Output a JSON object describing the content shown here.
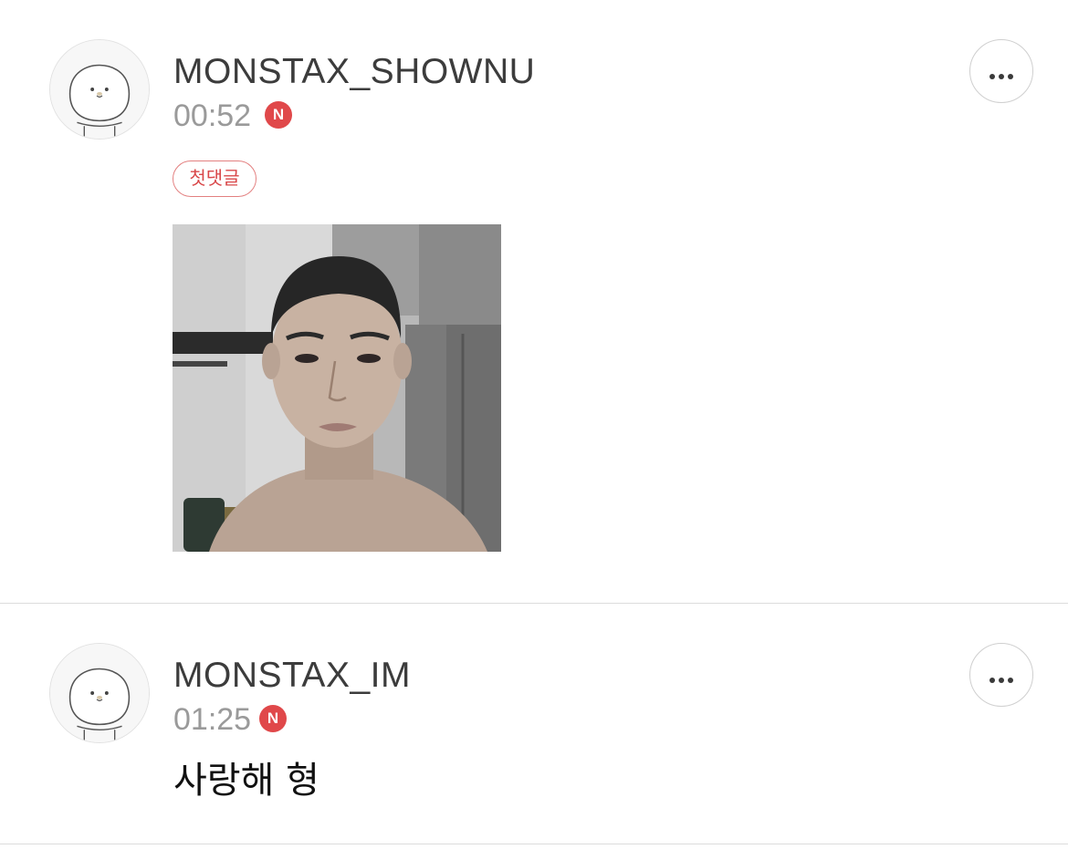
{
  "comments": [
    {
      "username": "MONSTAX_SHOWNU",
      "time": "00:52",
      "new_badge": "N",
      "tag": "첫댓글",
      "attachment_icon": "selfie-photo",
      "more_icon": "more-dots-icon"
    },
    {
      "username": "MONSTAX_IM",
      "time": "01:25",
      "new_badge": "N",
      "text": "사랑해 형",
      "more_icon": "more-dots-icon"
    }
  ],
  "colors": {
    "badge_red": "#e0484a",
    "tag_red": "#d9484a",
    "divider": "#dcdcdc",
    "username": "#3c3c3c",
    "timestamp": "#9a9a9a"
  }
}
